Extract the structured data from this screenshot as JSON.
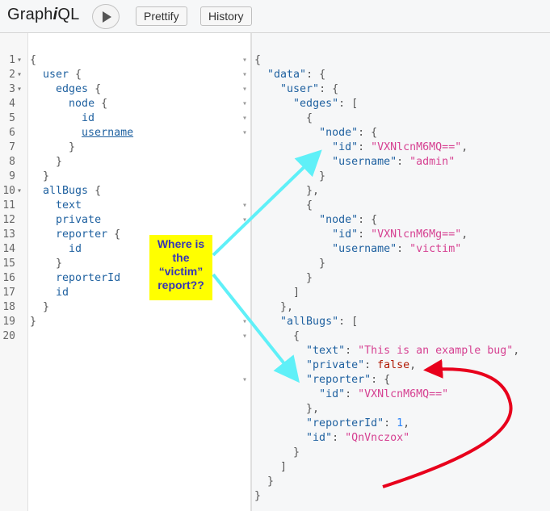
{
  "app": {
    "title_prefix": "Graph",
    "title_italic": "i",
    "title_suffix": "QL",
    "prettify_label": "Prettify",
    "history_label": "History"
  },
  "query_lines": [
    {
      "n": "1",
      "fold": "▾",
      "text": "{"
    },
    {
      "n": "2",
      "fold": "▾",
      "text": "  user {"
    },
    {
      "n": "3",
      "fold": "▾",
      "text": "    edges {"
    },
    {
      "n": "4",
      "fold": "",
      "text": "      node {"
    },
    {
      "n": "5",
      "fold": "",
      "text": "        id"
    },
    {
      "n": "6",
      "fold": "",
      "text": "        username"
    },
    {
      "n": "7",
      "fold": "",
      "text": "      }"
    },
    {
      "n": "8",
      "fold": "",
      "text": "    }"
    },
    {
      "n": "9",
      "fold": "",
      "text": "  }"
    },
    {
      "n": "10",
      "fold": "▾",
      "text": "  allBugs {"
    },
    {
      "n": "11",
      "fold": "",
      "text": "    text"
    },
    {
      "n": "12",
      "fold": "",
      "text": "    private"
    },
    {
      "n": "13",
      "fold": "",
      "text": "    reporter {"
    },
    {
      "n": "14",
      "fold": "",
      "text": "      id"
    },
    {
      "n": "15",
      "fold": "",
      "text": "    }"
    },
    {
      "n": "16",
      "fold": "",
      "text": "    reporterId"
    },
    {
      "n": "17",
      "fold": "",
      "text": "    id"
    },
    {
      "n": "18",
      "fold": "",
      "text": "  }"
    },
    {
      "n": "19",
      "fold": "",
      "text": "}"
    },
    {
      "n": "20",
      "fold": "",
      "text": ""
    }
  ],
  "result_lines": [
    "{",
    "  \"data\": {",
    "    \"user\": {",
    "      \"edges\": [",
    "        {",
    "          \"node\": {",
    "            \"id\": \"VXNlcnM6MQ==\",",
    "            \"username\": \"admin\"",
    "          }",
    "        },",
    "        {",
    "          \"node\": {",
    "            \"id\": \"VXNlcnM6Mg==\",",
    "            \"username\": \"victim\"",
    "          }",
    "        }",
    "      ]",
    "    },",
    "    \"allBugs\": [",
    "      {",
    "        \"text\": \"This is an example bug\",",
    "        \"private\": false,",
    "        \"reporter\": {",
    "          \"id\": \"VXNlcnM6MQ==\"",
    "        },",
    "        \"reporterId\": 1,",
    "        \"id\": \"QnVnczox\"",
    "      }",
    "    ]",
    "  }",
    "}"
  ],
  "result_fold_rows": [
    0,
    1,
    2,
    3,
    4,
    5,
    10,
    11,
    18,
    19,
    22
  ],
  "annotation": {
    "line1": "Where is",
    "line2": "the",
    "line3": "“victim”",
    "line4": "report??"
  },
  "colors": {
    "arrow_cyan": "#5ff0f8",
    "arrow_red": "#e8001c",
    "note_bg": "#ffff00",
    "note_text": "#3636b5"
  }
}
